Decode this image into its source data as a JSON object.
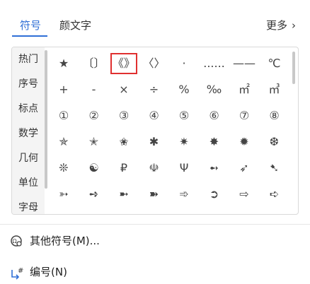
{
  "tabs": {
    "symbols": "符号",
    "emoticons": "颜文字",
    "more": "更多"
  },
  "sidebar": {
    "items": [
      {
        "label": "热门"
      },
      {
        "label": "序号"
      },
      {
        "label": "标点"
      },
      {
        "label": "数学"
      },
      {
        "label": "几何"
      },
      {
        "label": "单位"
      },
      {
        "label": "字母"
      }
    ]
  },
  "symbols": [
    [
      "★",
      "〔〕",
      "《》",
      "〈〉",
      "·",
      "......",
      "——",
      "℃"
    ],
    [
      "+",
      "-",
      "×",
      "÷",
      "%",
      "‰",
      "㎡",
      "㎥"
    ],
    [
      "①",
      "②",
      "③",
      "④",
      "⑤",
      "⑥",
      "⑦",
      "⑧"
    ],
    [
      "✯",
      "✭",
      "✬",
      "✱",
      "✷",
      "✸",
      "✹",
      "❆"
    ],
    [
      "❊",
      "☯",
      "₽",
      "☫",
      "Ψ",
      "➻",
      "➶",
      "➷"
    ],
    [
      "➳",
      "➺",
      "➼",
      "➽",
      "➾",
      "➲",
      "⇨",
      "➪"
    ]
  ],
  "bottom": {
    "other_symbols": "其他符号(M)...",
    "numbering": "编号(N)"
  },
  "colors": {
    "accent": "#2f6fd6",
    "selection": "#e03030"
  }
}
